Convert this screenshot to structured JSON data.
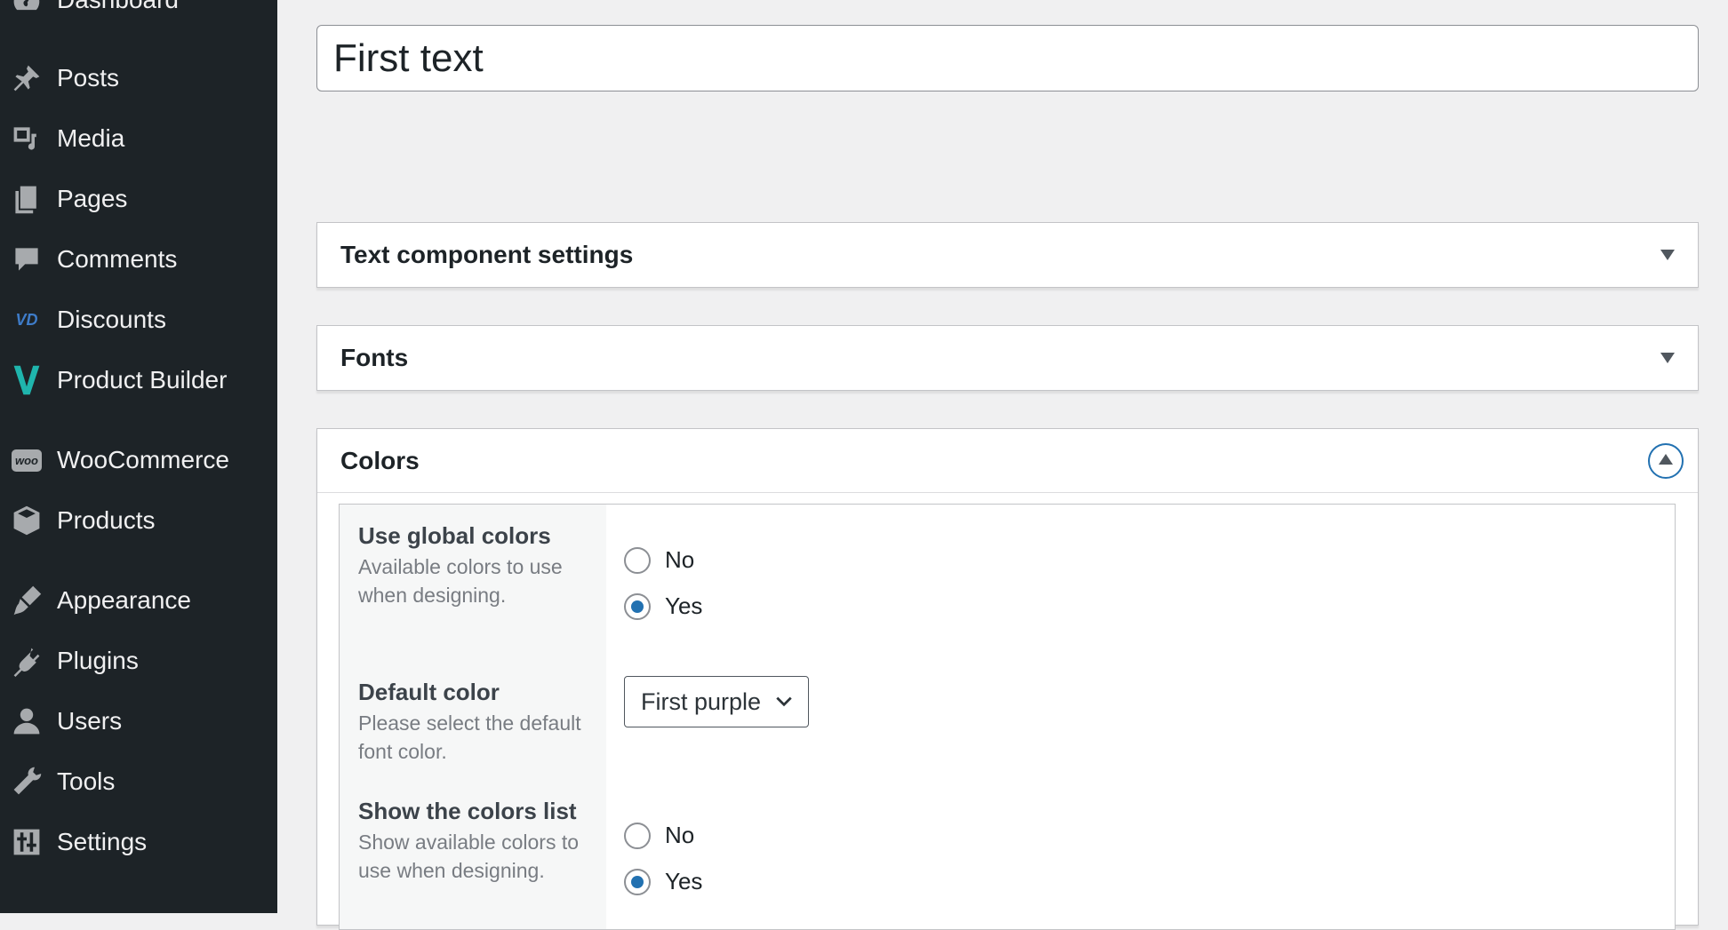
{
  "sidebar": {
    "items": [
      {
        "label": "Dashboard",
        "icon": "dashboard-icon"
      },
      {
        "label": "Posts",
        "icon": "pin-icon"
      },
      {
        "label": "Media",
        "icon": "media-icon"
      },
      {
        "label": "Pages",
        "icon": "pages-icon"
      },
      {
        "label": "Comments",
        "icon": "comment-icon"
      },
      {
        "label": "Discounts",
        "icon": "vd-logo-icon"
      },
      {
        "label": "Product Builder",
        "icon": "v-logo-icon"
      },
      {
        "label": "WooCommerce",
        "icon": "woo-icon"
      },
      {
        "label": "Products",
        "icon": "box-icon"
      },
      {
        "label": "Appearance",
        "icon": "brush-icon"
      },
      {
        "label": "Plugins",
        "icon": "plug-icon"
      },
      {
        "label": "Users",
        "icon": "user-icon"
      },
      {
        "label": "Tools",
        "icon": "wrench-icon"
      },
      {
        "label": "Settings",
        "icon": "sliders-icon"
      }
    ]
  },
  "title_input": {
    "value": "First text"
  },
  "panels": {
    "text_settings": {
      "title": "Text component settings"
    },
    "fonts": {
      "title": "Fonts"
    },
    "colors": {
      "title": "Colors"
    }
  },
  "colors": {
    "global": {
      "title": "Use global colors",
      "description": "Available colors to use when designing.",
      "options": [
        "No",
        "Yes"
      ],
      "selected": "Yes"
    },
    "default_color": {
      "title": "Default color",
      "description": "Please select the default font color.",
      "selected": "First purple"
    },
    "show_list": {
      "title": "Show the colors list",
      "description": "Show available colors to use when designing.",
      "options": [
        "No",
        "Yes"
      ],
      "selected": "Yes"
    }
  },
  "accent_color": "#2271b1"
}
